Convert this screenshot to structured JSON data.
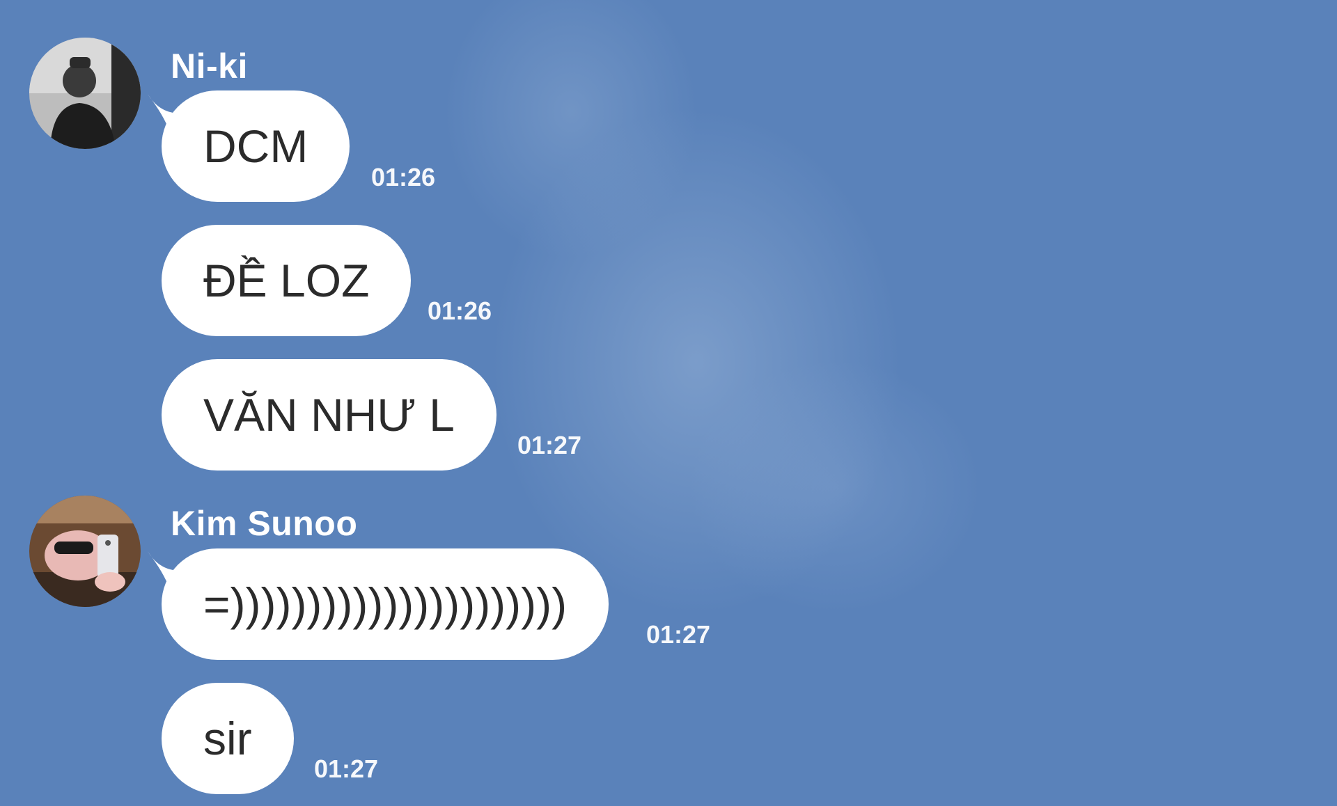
{
  "background_color": "#5a82ba",
  "bubble_color": "#ffffff",
  "conversation": [
    {
      "sender": "Ni-ki",
      "avatar_icon": "user-avatar-dark-photo",
      "messages": [
        {
          "text": "DCM",
          "time": "01:26"
        },
        {
          "text": "ĐỀ LOZ",
          "time": "01:26"
        },
        {
          "text": "VĂN NHƯ L",
          "time": "01:27"
        }
      ]
    },
    {
      "sender": "Kim Sunoo",
      "avatar_icon": "user-avatar-selfie-photo",
      "messages": [
        {
          "text": "=))))))))))))))))))))))",
          "time": "01:27"
        },
        {
          "text": "sir",
          "time": "01:27"
        }
      ]
    }
  ]
}
